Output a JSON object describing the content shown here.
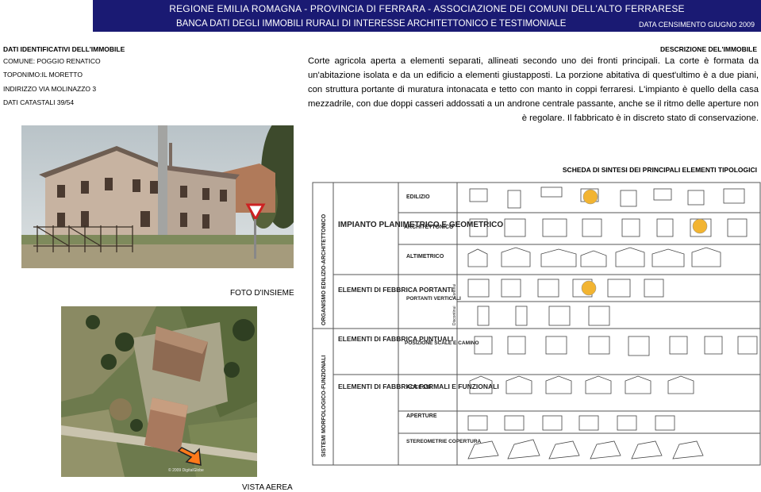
{
  "header": {
    "line1": "REGIONE EMILIA ROMAGNA - PROVINCIA DI FERRARA - ASSOCIAZIONE DEI COMUNI DELL'ALTO FERRARESE",
    "line2": "BANCA DATI DEGLI IMMOBILI RURALI DI INTERESSE ARCHITETTONICO E TESTIMONIALE",
    "census": "DATA CENSIMENTO GIUGNO 2009"
  },
  "ident": {
    "title": "DATI IDENTIFICATIVI DELL'IMMOBILE",
    "comune": "COMUNE: POGGIO RENATICO",
    "toponimo": "TOPONIMO:IL MORETTO",
    "indirizzo": "INDIRIZZO  VIA MOLINAZZO 3",
    "catastali": "DATI CATASTALI  39/54"
  },
  "description": {
    "title": "DESCRIZIONE DEL'IMMOBILE",
    "text": "Corte agricola aperta a elementi separati, allineati secondo uno dei fronti principali. La corte è formata da un'abitazione isolata e da un edificio a elementi giustapposti. La porzione abitativa di quest'ultimo è a due piani, con struttura portante di muratura intonacata e tetto con manto in coppi ferraresi. L'impianto è quello della casa mezzadrile, con due doppi casseri addossati a un androne centrale passante, anche se il ritmo delle aperture non è regolare. Il fabbricato è in discreto stato di conservazione."
  },
  "captions": {
    "photo": "FOTO D'INSIEME",
    "aerial": "VISTA AEREA",
    "aerial_credit": "© 2009 DigitalGlobe"
  },
  "schema": {
    "title": "SCHEDA DI SINTESI DEI PRINCIPALI ELEMENTI TIPOLOGICI",
    "side_top": "ORGANISMO   EDILIZIO-ARCHITETTONICO",
    "side_bottom": "SISTEMI MORFOLOGICO-FUNZIONALI",
    "group1": "IMPIANTO PLANIMETRICO E GEOMETRICO",
    "group2": "ELEMENTI DI FEBBRICA PORTANTI",
    "group3": "ELEMENTI DI FABBRICA PUNTUALI",
    "group4": "ELEMENTI DI FABBRICA FORMALI E FUNZIONALI",
    "rows": {
      "edilizio": "EDILIZIO",
      "architettonico": "ARCHITETTONICO",
      "altimetrico": "ALTIMETRICO",
      "portanti": "PORTANTI VERTICALI",
      "continui": "Continui",
      "discontinui": "Discontinui",
      "posizione": "POSIZIONE SCALE E CAMINO",
      "accessi": "ACCESSI",
      "aperture": "APERTURE",
      "stereometrie": "STEREOMETRIE COPERTURA"
    },
    "highlight_color": "#f2b431"
  }
}
